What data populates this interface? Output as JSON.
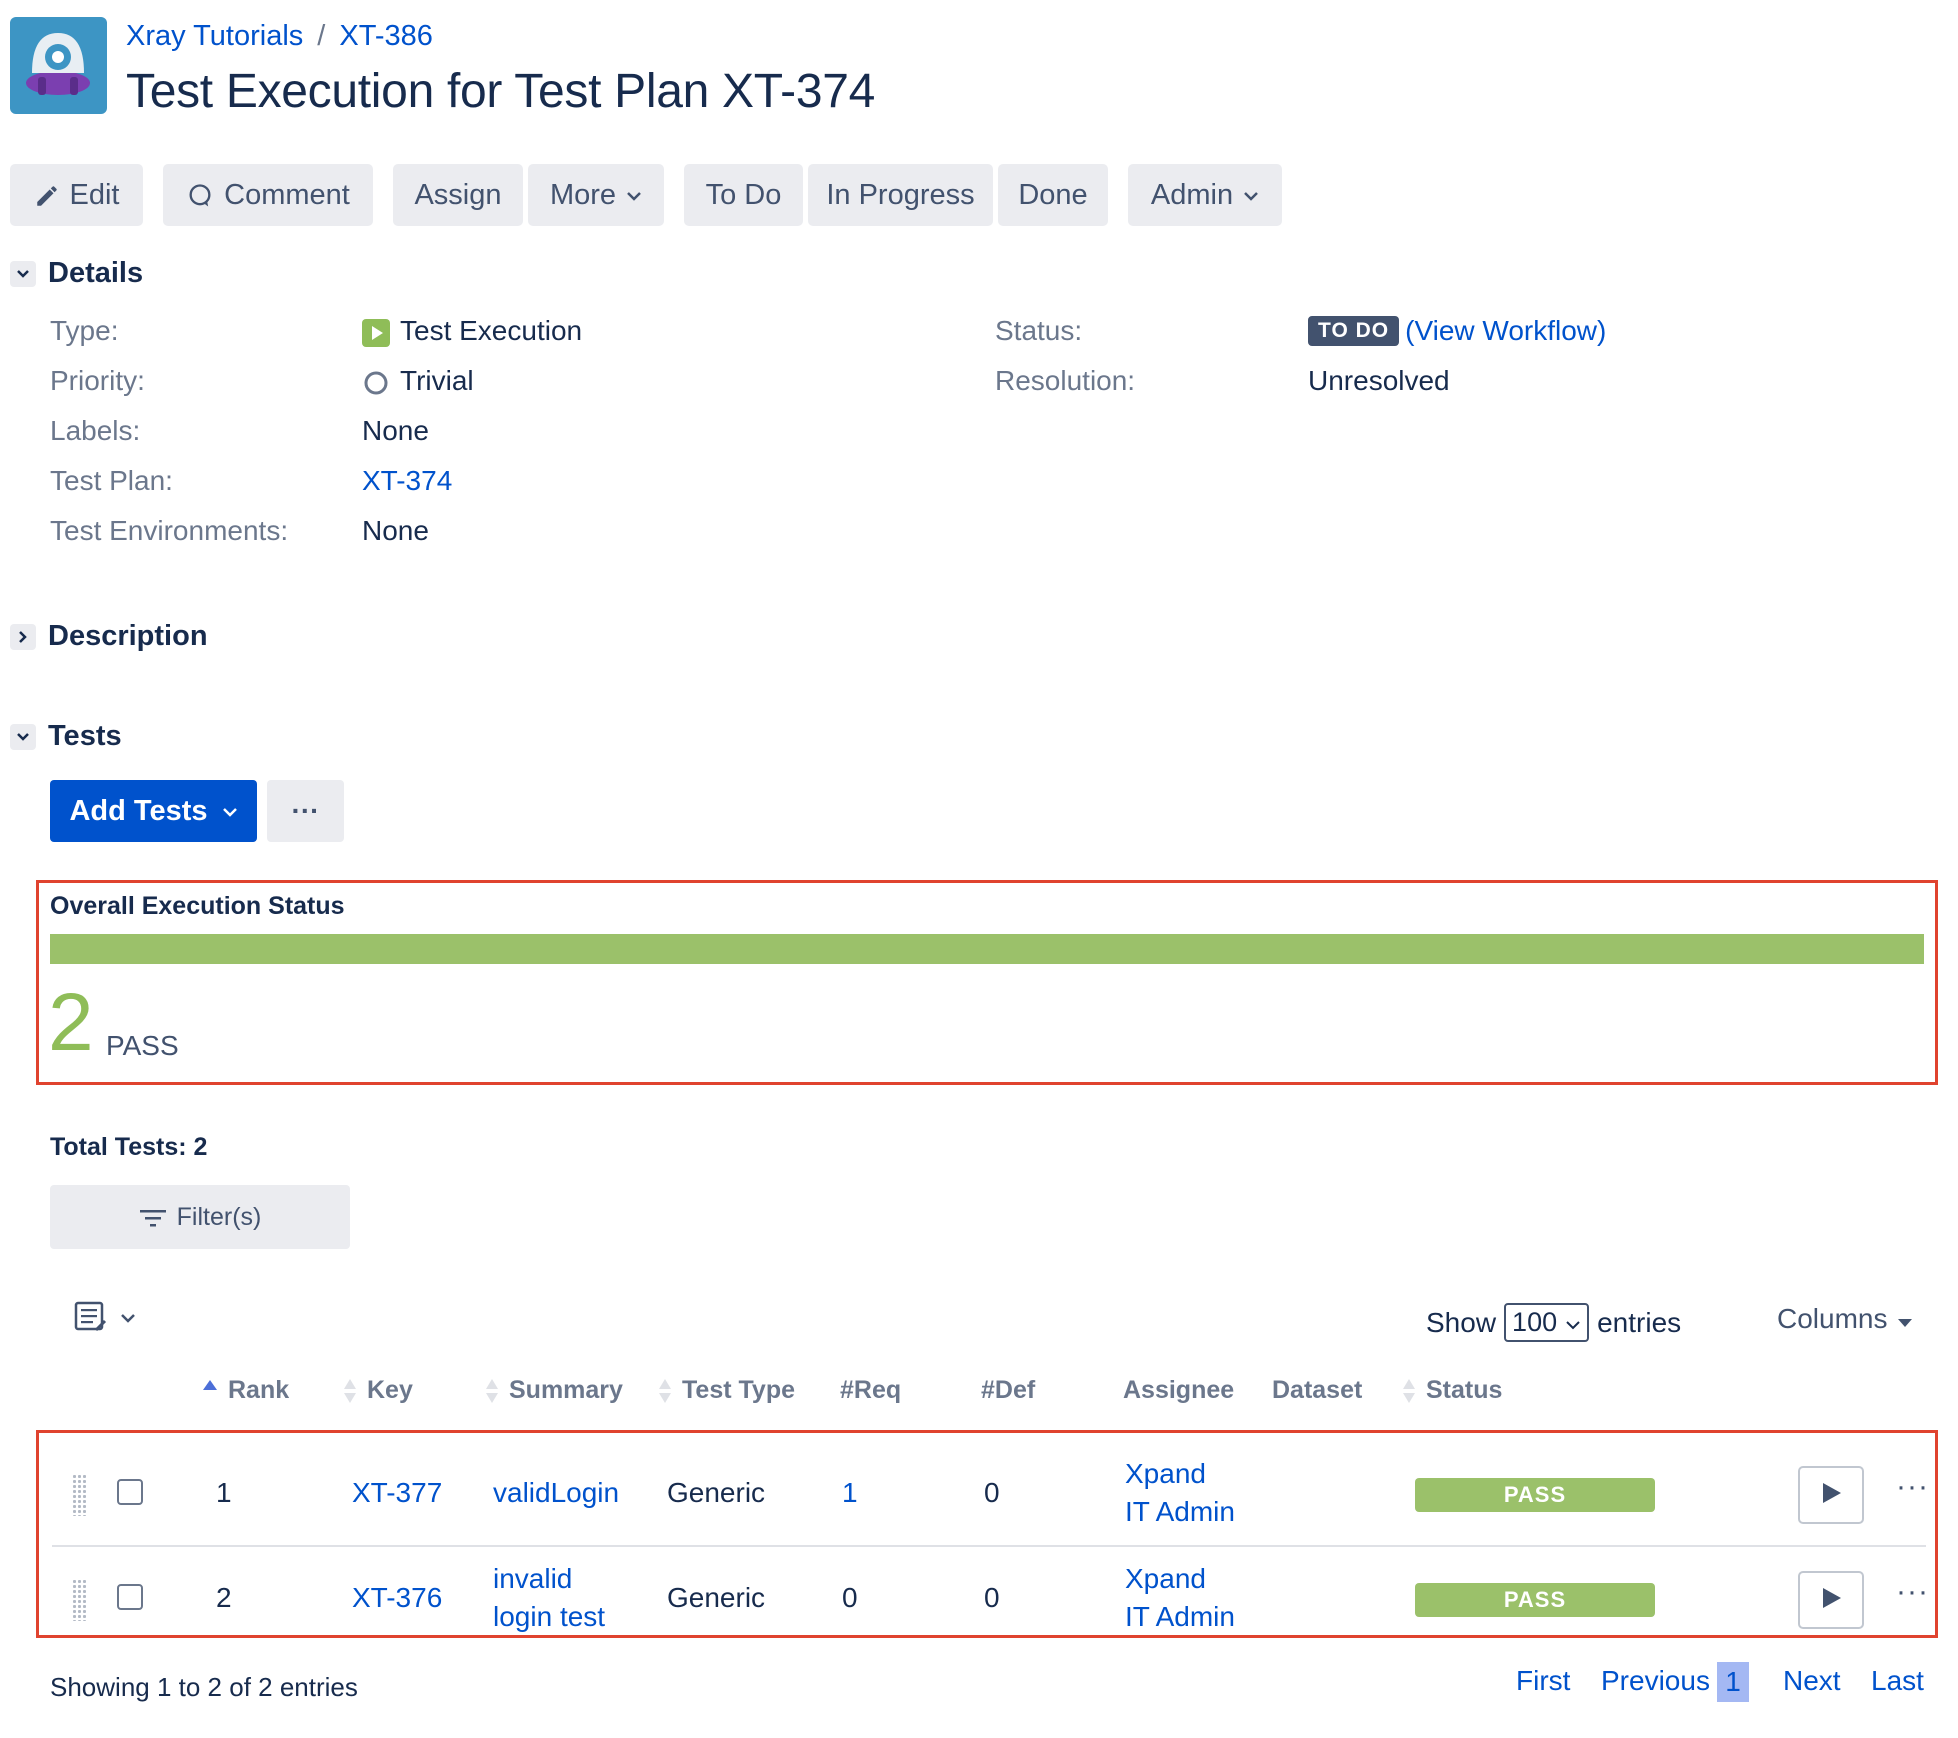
{
  "breadcrumb": {
    "project": "Xray Tutorials",
    "separator": "/",
    "issue_key": "XT-386"
  },
  "title": "Test Execution for Test Plan XT-374",
  "toolbar": {
    "edit": "Edit",
    "comment": "Comment",
    "assign": "Assign",
    "more": "More",
    "todo": "To Do",
    "in_progress": "In Progress",
    "done": "Done",
    "admin": "Admin"
  },
  "details": {
    "heading": "Details",
    "type_label": "Type:",
    "type_value": "Test Execution",
    "priority_label": "Priority:",
    "priority_value": "Trivial",
    "labels_label": "Labels:",
    "labels_value": "None",
    "test_plan_label": "Test Plan:",
    "test_plan_value": "XT-374",
    "env_label": "Test Environments:",
    "env_value": "None",
    "status_label": "Status:",
    "status_value": "TO DO",
    "workflow_open": "(",
    "workflow_link": "View Workflow",
    "workflow_close": ")",
    "resolution_label": "Resolution:",
    "resolution_value": "Unresolved"
  },
  "description": {
    "heading": "Description"
  },
  "tests": {
    "heading": "Tests",
    "add_tests": "Add Tests",
    "more_actions": "···",
    "overall_title": "Overall Execution Status",
    "overall_count": "2",
    "overall_label": "PASS",
    "pass_fraction": 1.0,
    "total_tests": "Total Tests: 2",
    "filter": "Filter(s)",
    "show_label": "Show",
    "entries_value": "100",
    "entries_label": "entries",
    "columns_label": "Columns",
    "headers": {
      "rank": "Rank",
      "key": "Key",
      "summary": "Summary",
      "test_type": "Test Type",
      "req": "#Req",
      "def": "#Def",
      "assignee": "Assignee",
      "dataset": "Dataset",
      "status": "Status"
    },
    "rows": [
      {
        "rank": "1",
        "key": "XT-377",
        "summary_line1": "validLogin",
        "summary_line2": "",
        "test_type": "Generic",
        "req": "1",
        "def": "0",
        "assignee_line1": "Xpand",
        "assignee_line2": "IT Admin",
        "status": "PASS"
      },
      {
        "rank": "2",
        "key": "XT-376",
        "summary_line1": "invalid",
        "summary_line2": "login test",
        "test_type": "Generic",
        "req": "0",
        "def": "0",
        "assignee_line1": "Xpand",
        "assignee_line2": "IT Admin",
        "status": "PASS"
      }
    ],
    "row_more": "···",
    "showing": "Showing 1 to 2 of 2 entries",
    "pagination": {
      "first": "First",
      "previous": "Previous",
      "current": "1",
      "next": "Next",
      "last": "Last"
    }
  },
  "colors": {
    "accent": "#0052cc",
    "pass": "#9bc16a",
    "highlight": "#e0432f",
    "lozenge": "#42526e"
  },
  "icons": [
    "project-avatar-icon",
    "pencil-icon",
    "comment-icon",
    "chevron-down-icon",
    "test-execution-icon",
    "priority-trivial-icon",
    "filter-icon",
    "column-view-icon",
    "sort-icon",
    "play-icon",
    "drag-handle-icon"
  ]
}
